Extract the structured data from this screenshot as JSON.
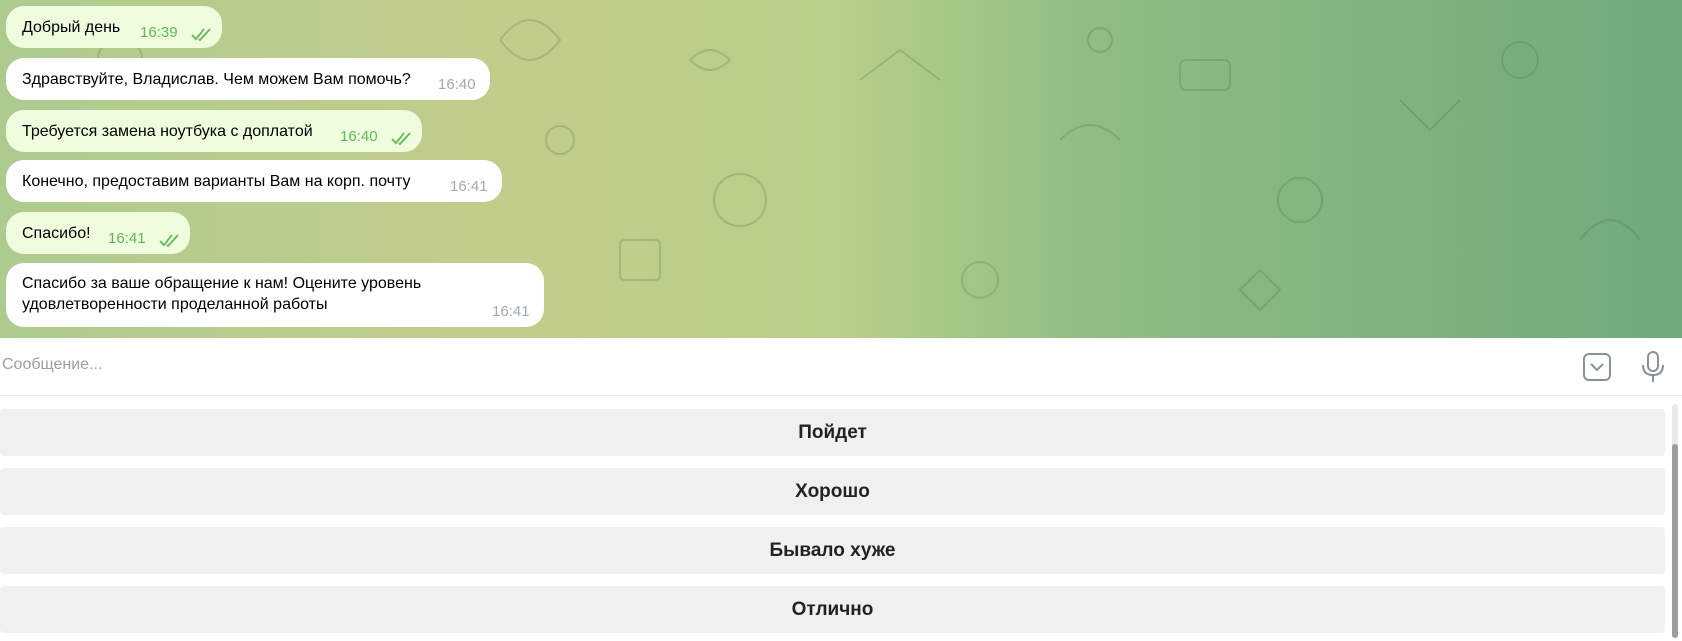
{
  "messages": [
    {
      "text": "Добрый день",
      "time": "16:39",
      "direction": "out",
      "read": true
    },
    {
      "text": "Здравствуйте, Владислав. Чем можем Вам помочь?",
      "time": "16:40",
      "direction": "in"
    },
    {
      "text": "Требуется замена ноутбука с доплатой",
      "time": "16:40",
      "direction": "out",
      "read": true
    },
    {
      "text": "Конечно, предоставим варианты Вам на корп. почту",
      "time": "16:41",
      "direction": "in"
    },
    {
      "text": "Спасибо!",
      "time": "16:41",
      "direction": "out",
      "read": true
    },
    {
      "text": "Спасибо за ваше обращение к нам! Оцените уровень\nудовлетворенности проделанной работы",
      "time": "16:41",
      "direction": "in"
    }
  ],
  "composer": {
    "placeholder": "Сообщение...",
    "keyboard_icon": "keyboard-toggle-icon",
    "mic_icon": "microphone-icon"
  },
  "reply_keyboard": {
    "buttons": [
      "Пойдет",
      "Хорошо",
      "Бывало хуже",
      "Отлично"
    ]
  },
  "colors": {
    "outgoing_bubble": "#effdde",
    "incoming_bubble": "#ffffff",
    "read_ticks": "#5fb857",
    "button_bg": "#f0f0f0"
  }
}
